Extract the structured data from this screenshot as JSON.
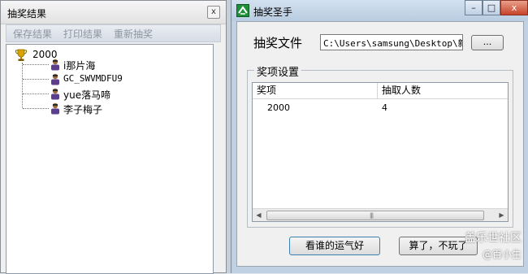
{
  "left_window": {
    "title": "抽奖结果",
    "close_label": "x",
    "toolbar": {
      "save": "保存结果",
      "print": "打印结果",
      "redraw": "重新抽奖"
    },
    "tree": {
      "root_label": "2000",
      "winners": [
        "i那片海",
        "GC_SWVMDFU9",
        "yue落马啼",
        "李子梅子"
      ]
    }
  },
  "right_window": {
    "title": "抽奖圣手",
    "controls": {
      "minimize": "–",
      "maximize": "□",
      "close": "x"
    },
    "file_label": "抽奖文件",
    "file_path": "C:\\Users\\samsung\\Desktop\\新建",
    "browse_label": "...",
    "group_label": "奖项设置",
    "list": {
      "columns": [
        "奖项",
        "抽取人数"
      ],
      "rows": [
        {
          "prize": "2000",
          "count": "4"
        }
      ]
    },
    "buttons": {
      "lucky": "看谁的运气好",
      "quit": "算了，不玩了"
    }
  },
  "watermark": {
    "line1": "盖乐世社区",
    "line2": "@百小生"
  },
  "colors": {
    "accent_blue": "#3c7fb1",
    "close_red": "#c7432a",
    "titlebar_blue": "#b9cce0"
  }
}
